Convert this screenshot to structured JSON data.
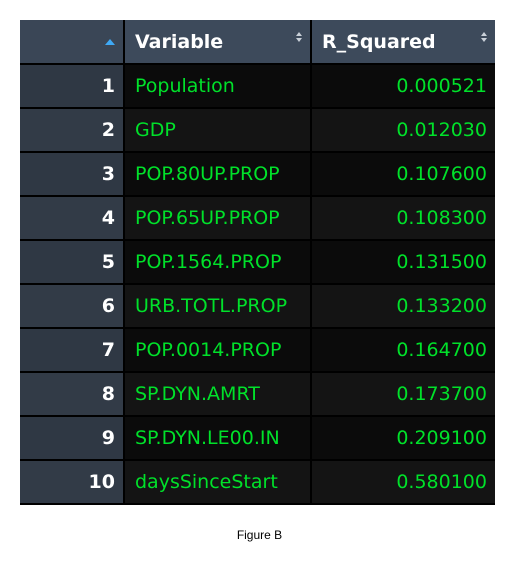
{
  "table": {
    "columns": {
      "index_sort_icon": "sort-ascending-icon",
      "variable": "Variable",
      "r_squared": "R_Squared"
    },
    "rows": [
      {
        "index": "1",
        "variable": "Population",
        "r_squared": "0.000521"
      },
      {
        "index": "2",
        "variable": "GDP",
        "r_squared": "0.012030"
      },
      {
        "index": "3",
        "variable": "POP.80UP.PROP",
        "r_squared": "0.107600"
      },
      {
        "index": "4",
        "variable": "POP.65UP.PROP",
        "r_squared": "0.108300"
      },
      {
        "index": "5",
        "variable": "POP.1564.PROP",
        "r_squared": "0.131500"
      },
      {
        "index": "6",
        "variable": "URB.TOTL.PROP",
        "r_squared": "0.133200"
      },
      {
        "index": "7",
        "variable": "POP.0014.PROP",
        "r_squared": "0.164700"
      },
      {
        "index": "8",
        "variable": "SP.DYN.AMRT",
        "r_squared": "0.173700"
      },
      {
        "index": "9",
        "variable": "SP.DYN.LE00.IN",
        "r_squared": "0.209100"
      },
      {
        "index": "10",
        "variable": "daysSinceStart",
        "r_squared": "0.580100"
      }
    ]
  },
  "caption": "Figure B",
  "colors": {
    "header_bg": "#3d4a5b",
    "index_bg": "#2f3844",
    "cell_text": "#00e12a",
    "sort_active": "#3fa9f5"
  }
}
